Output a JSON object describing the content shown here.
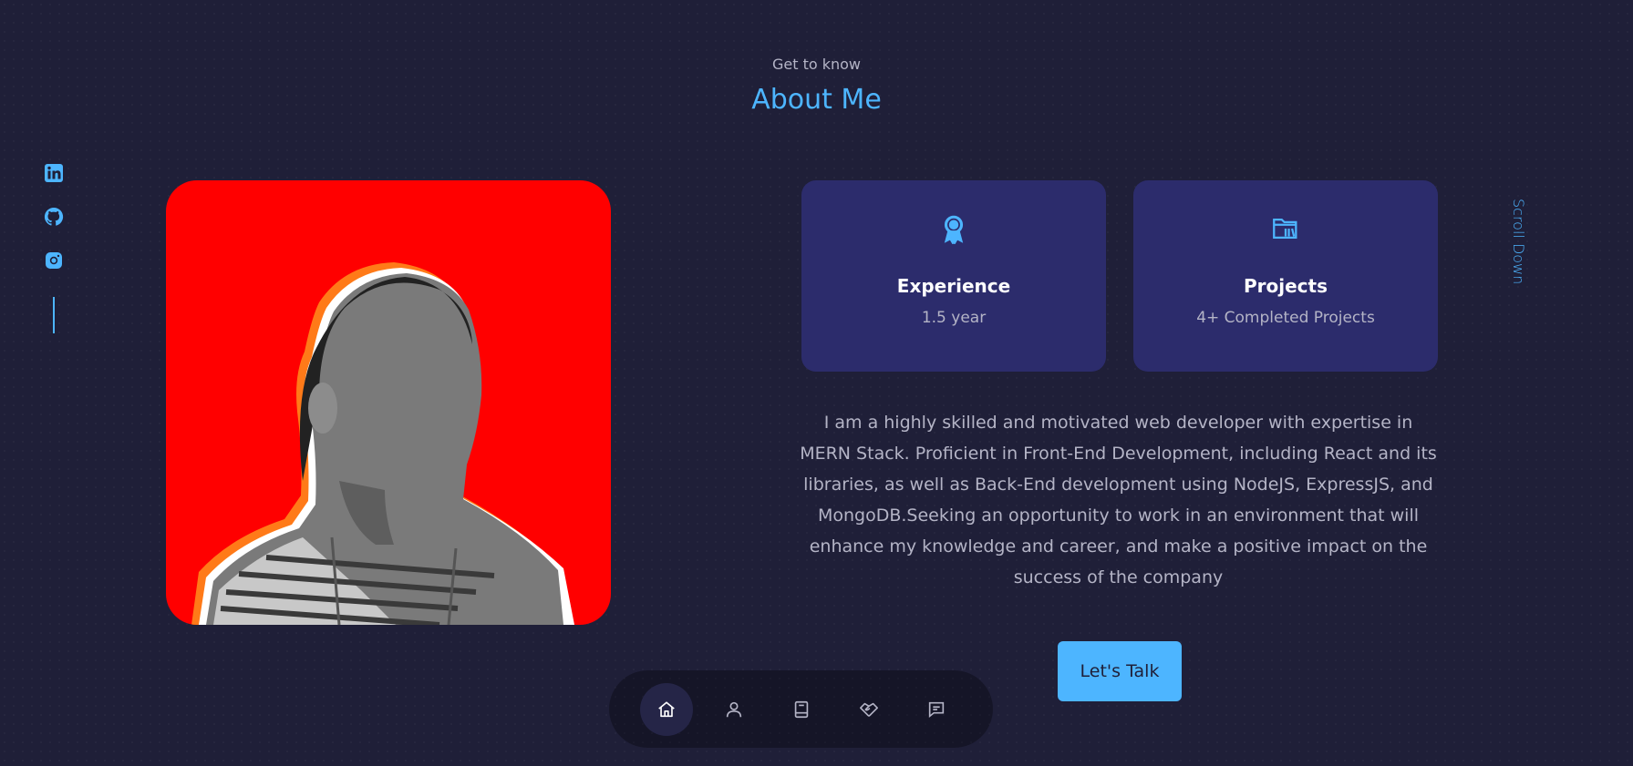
{
  "header": {
    "subtitle": "Get to know",
    "title": "About Me"
  },
  "socials": [
    {
      "name": "linkedin",
      "icon": "linkedin-icon"
    },
    {
      "name": "github",
      "icon": "github-icon"
    },
    {
      "name": "instagram",
      "icon": "instagram-icon"
    }
  ],
  "cards": {
    "experience": {
      "icon": "award-icon",
      "title": "Experience",
      "value": "1.5 year"
    },
    "projects": {
      "icon": "folder-icon",
      "title": "Projects",
      "value": "4+ Completed Projects"
    }
  },
  "bio": "I am a highly skilled and motivated web developer with expertise in MERN Stack. Proficient in Front-End Development, including React and its libraries, as well as Back-End development using NodeJS, ExpressJS, and MongoDB.Seeking an opportunity to work in an environment that will enhance my knowledge and career, and make a positive impact on the success of the company",
  "cta": {
    "label": "Let's Talk"
  },
  "scroll": {
    "label": "Scroll Down"
  },
  "nav": [
    {
      "name": "home",
      "icon": "home-icon",
      "active": true
    },
    {
      "name": "about",
      "icon": "user-icon",
      "active": false
    },
    {
      "name": "experience",
      "icon": "book-icon",
      "active": false
    },
    {
      "name": "services",
      "icon": "handshake-icon",
      "active": false
    },
    {
      "name": "contact",
      "icon": "message-icon",
      "active": false
    }
  ],
  "colors": {
    "background": "#1f1f38",
    "accent": "#4db5ff",
    "card": "#2c2c6c",
    "text_light": "#b4b4c6",
    "photo_background": "#ff0000"
  }
}
